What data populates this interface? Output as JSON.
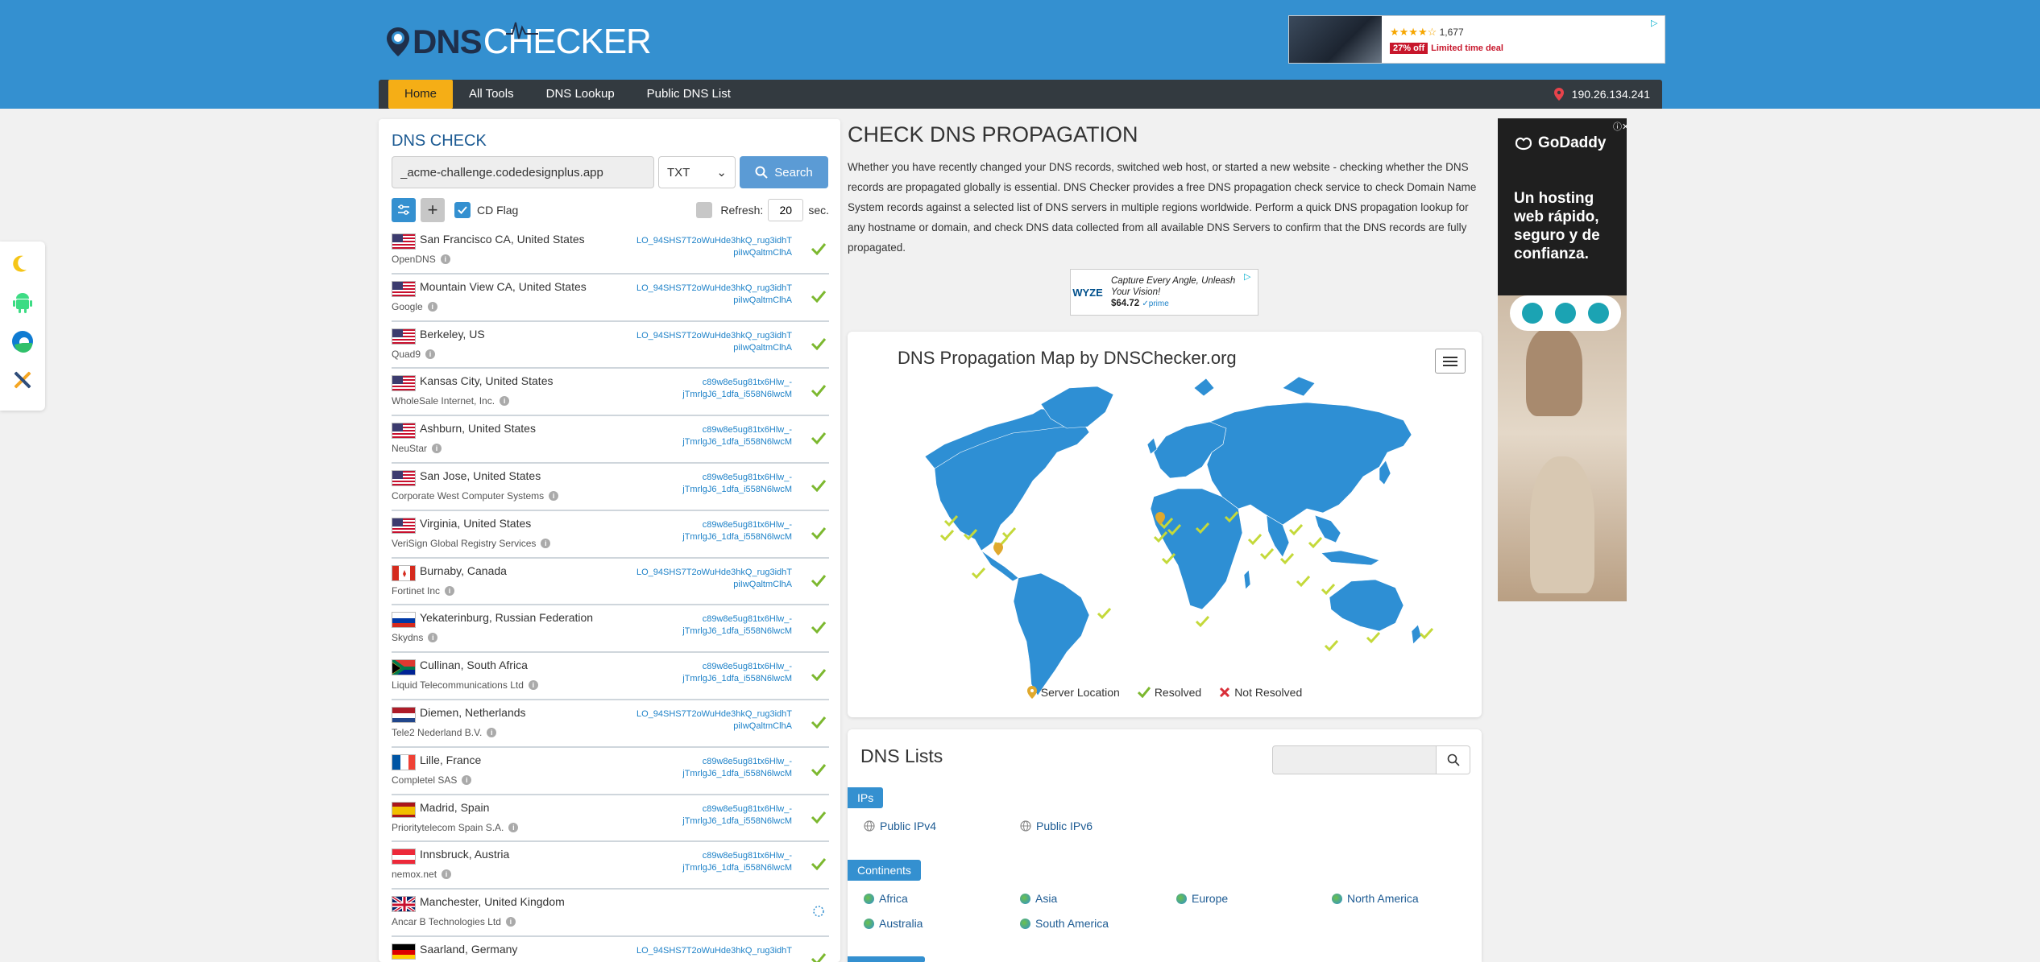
{
  "header": {
    "logo_text_dark": "DNS",
    "logo_text_light": "CHECKER",
    "ad": {
      "rating_count": "1,677",
      "discount": "27% off",
      "deal_text": "Limited time deal"
    }
  },
  "nav": {
    "items": [
      {
        "label": "Home",
        "active": true
      },
      {
        "label": "All Tools",
        "active": false
      },
      {
        "label": "DNS Lookup",
        "active": false
      },
      {
        "label": "Public DNS List",
        "active": false
      }
    ],
    "ip": "190.26.134.241"
  },
  "side_tools": [
    "moon-icon",
    "android-icon",
    "edge-icon",
    "tools-icon"
  ],
  "dns_check": {
    "title": "DNS CHECK",
    "hostname": "_acme-challenge.codedesignplus.app",
    "record_type": "TXT",
    "search_label": "Search",
    "cd_flag_label": "CD Flag",
    "refresh_label": "Refresh:",
    "refresh_value": "20",
    "refresh_unit": "sec.",
    "results": [
      {
        "location": "San Francisco CA, United States",
        "provider": "OpenDNS",
        "flag": "us",
        "value": "LO_94SHS7T2oWuHde3hkQ_rug3idhT piIwQaltmClhA",
        "status": "resolved"
      },
      {
        "location": "Mountain View CA, United States",
        "provider": "Google",
        "flag": "us",
        "value": "LO_94SHS7T2oWuHde3hkQ_rug3idhT piIwQaltmClhA",
        "status": "resolved"
      },
      {
        "location": "Berkeley, US",
        "provider": "Quad9",
        "flag": "us",
        "value": "LO_94SHS7T2oWuHde3hkQ_rug3idhT piIwQaltmClhA",
        "status": "resolved"
      },
      {
        "location": "Kansas City, United States",
        "provider": "WholeSale Internet, Inc.",
        "flag": "us",
        "value": "c89w8e5ug81tx6Hlw_- jTmrlgJ6_1dfa_i558N6lwcM",
        "status": "resolved"
      },
      {
        "location": "Ashburn, United States",
        "provider": "NeuStar",
        "flag": "us",
        "value": "c89w8e5ug81tx6Hlw_- jTmrlgJ6_1dfa_i558N6lwcM",
        "status": "resolved"
      },
      {
        "location": "San Jose, United States",
        "provider": "Corporate West Computer Systems",
        "flag": "us",
        "value": "c89w8e5ug81tx6Hlw_- jTmrlgJ6_1dfa_i558N6lwcM",
        "status": "resolved"
      },
      {
        "location": "Virginia, United States",
        "provider": "VeriSign Global Registry Services",
        "flag": "us",
        "value": "c89w8e5ug81tx6Hlw_- jTmrlgJ6_1dfa_i558N6lwcM",
        "status": "resolved"
      },
      {
        "location": "Burnaby, Canada",
        "provider": "Fortinet Inc",
        "flag": "ca",
        "value": "LO_94SHS7T2oWuHde3hkQ_rug3idhT piIwQaltmClhA",
        "status": "resolved"
      },
      {
        "location": "Yekaterinburg, Russian Federation",
        "provider": "Skydns",
        "flag": "ru",
        "value": "c89w8e5ug81tx6Hlw_- jTmrlgJ6_1dfa_i558N6lwcM",
        "status": "resolved"
      },
      {
        "location": "Cullinan, South Africa",
        "provider": "Liquid Telecommunications Ltd",
        "flag": "za",
        "value": "c89w8e5ug81tx6Hlw_- jTmrlgJ6_1dfa_i558N6lwcM",
        "status": "resolved"
      },
      {
        "location": "Diemen, Netherlands",
        "provider": "Tele2 Nederland B.V.",
        "flag": "nl",
        "value": "LO_94SHS7T2oWuHde3hkQ_rug3idhT piIwQaltmClhA",
        "status": "resolved"
      },
      {
        "location": "Lille, France",
        "provider": "Completel SAS",
        "flag": "fr",
        "value": "c89w8e5ug81tx6Hlw_- jTmrlgJ6_1dfa_i558N6lwcM",
        "status": "resolved"
      },
      {
        "location": "Madrid, Spain",
        "provider": "Prioritytelecom Spain S.A.",
        "flag": "es",
        "value": "c89w8e5ug81tx6Hlw_- jTmrlgJ6_1dfa_i558N6lwcM",
        "status": "resolved"
      },
      {
        "location": "Innsbruck, Austria",
        "provider": "nemox.net",
        "flag": "at",
        "value": "c89w8e5ug81tx6Hlw_- jTmrlgJ6_1dfa_i558N6lwcM",
        "status": "resolved"
      },
      {
        "location": "Manchester, United Kingdom",
        "provider": "Ancar B Technologies Ltd",
        "flag": "gb",
        "value": "",
        "status": "loading"
      },
      {
        "location": "Saarland, Germany",
        "provider": "",
        "flag": "de",
        "value": "LO_94SHS7T2oWuHde3hkQ_rug3idhT",
        "status": "resolved"
      }
    ]
  },
  "main": {
    "title": "CHECK DNS PROPAGATION",
    "description": "Whether you have recently changed your DNS records, switched web host, or started a new website - checking whether the DNS records are propagated globally is essential. DNS Checker provides a free DNS propagation check service to check Domain Name System records against a selected list of DNS servers in multiple regions worldwide. Perform a quick DNS propagation lookup for any hostname or domain, and check DNS data collected from all available DNS Servers to confirm that the DNS records are fully propagated.",
    "mid_ad": {
      "brand": "WYZE",
      "line1": "Capture Every Angle, Unleash",
      "line2": "Your Vision!",
      "price": "$64.72",
      "prime": "✓prime"
    }
  },
  "map": {
    "title": "DNS Propagation Map by DNSChecker.org",
    "legend": {
      "server": "Server Location",
      "resolved": "Resolved",
      "not_resolved": "Not Resolved"
    }
  },
  "dns_lists": {
    "title": "DNS Lists",
    "ips_badge": "IPs",
    "ips": [
      "Public IPv4",
      "Public IPv6"
    ],
    "continents_badge": "Continents",
    "continents": [
      "Africa",
      "Asia",
      "Europe",
      "North America",
      "Australia",
      "South America"
    ]
  },
  "right_ad": {
    "brand": "GoDaddy",
    "slogan_1": "Un hosting",
    "slogan_2": "web rápido,",
    "slogan_3": "seguro y de",
    "slogan_4": "confianza."
  },
  "colors": {
    "header_blue": "#3490d0",
    "nav_dark": "#333a40",
    "nav_active": "#f5ae16",
    "resolved_green": "#7cb82f",
    "link_blue": "#1e82c8"
  }
}
